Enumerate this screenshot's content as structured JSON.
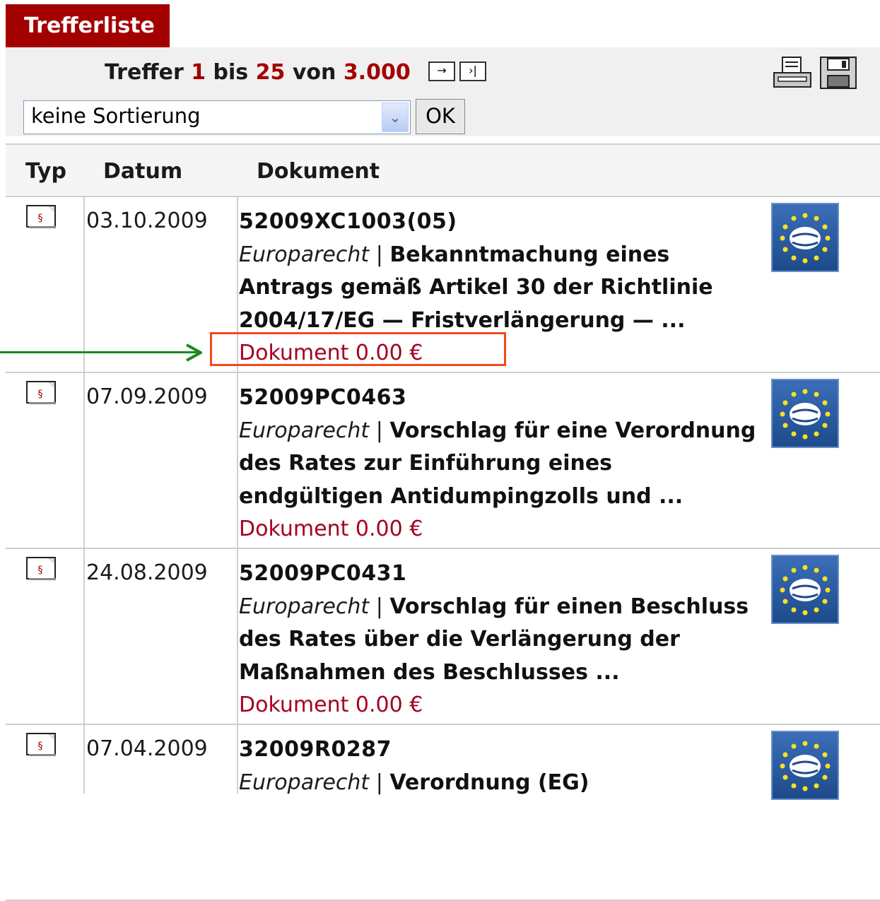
{
  "tab": {
    "label": "Trefferliste"
  },
  "counter": {
    "prefix": "Treffer",
    "from": "1",
    "mid": "bis",
    "to": "25",
    "of": "von",
    "total": "3.000"
  },
  "nav": {
    "next": "→",
    "last": "›|"
  },
  "sort": {
    "selected": "keine Sortierung",
    "ok_label": "OK"
  },
  "columns": {
    "typ": "Typ",
    "datum": "Datum",
    "dokument": "Dokument"
  },
  "results": [
    {
      "date": "03.10.2009",
      "id": "52009XC1003(05)",
      "category": "Europarecht",
      "separator": "|",
      "title": "Bekanntmachung eines Antrags gemäß Artikel 30 der Richtlinie 2004/17/EG — Fristverlängerung — ...",
      "price": "Dokument 0.00 €"
    },
    {
      "date": "07.09.2009",
      "id": "52009PC0463",
      "category": "Europarecht",
      "separator": "|",
      "title": "Vorschlag für eine Verordnung des Rates zur Einführung eines endgültigen Antidumpingzolls und ...",
      "price": "Dokument 0.00 €"
    },
    {
      "date": "24.08.2009",
      "id": "52009PC0431",
      "category": "Europarecht",
      "separator": "|",
      "title": "Vorschlag für einen Beschluss des Rates über die Verlängerung der Maßnahmen des Beschlusses ...",
      "price": "Dokument 0.00 €"
    },
    {
      "date": "07.04.2009",
      "id": "32009R0287",
      "category": "Europarecht",
      "separator": "|",
      "title": "Verordnung (EG)",
      "price": ""
    }
  ],
  "icons": {
    "doc_type": "law-document-icon",
    "print": "printer-icon",
    "save": "floppy-disk-icon",
    "source_logo": "eu-op-logo"
  },
  "colors": {
    "accent": "#a30000",
    "price": "#a30022",
    "highlight_box": "#f04a1c",
    "arrow": "#1a8a1a"
  }
}
